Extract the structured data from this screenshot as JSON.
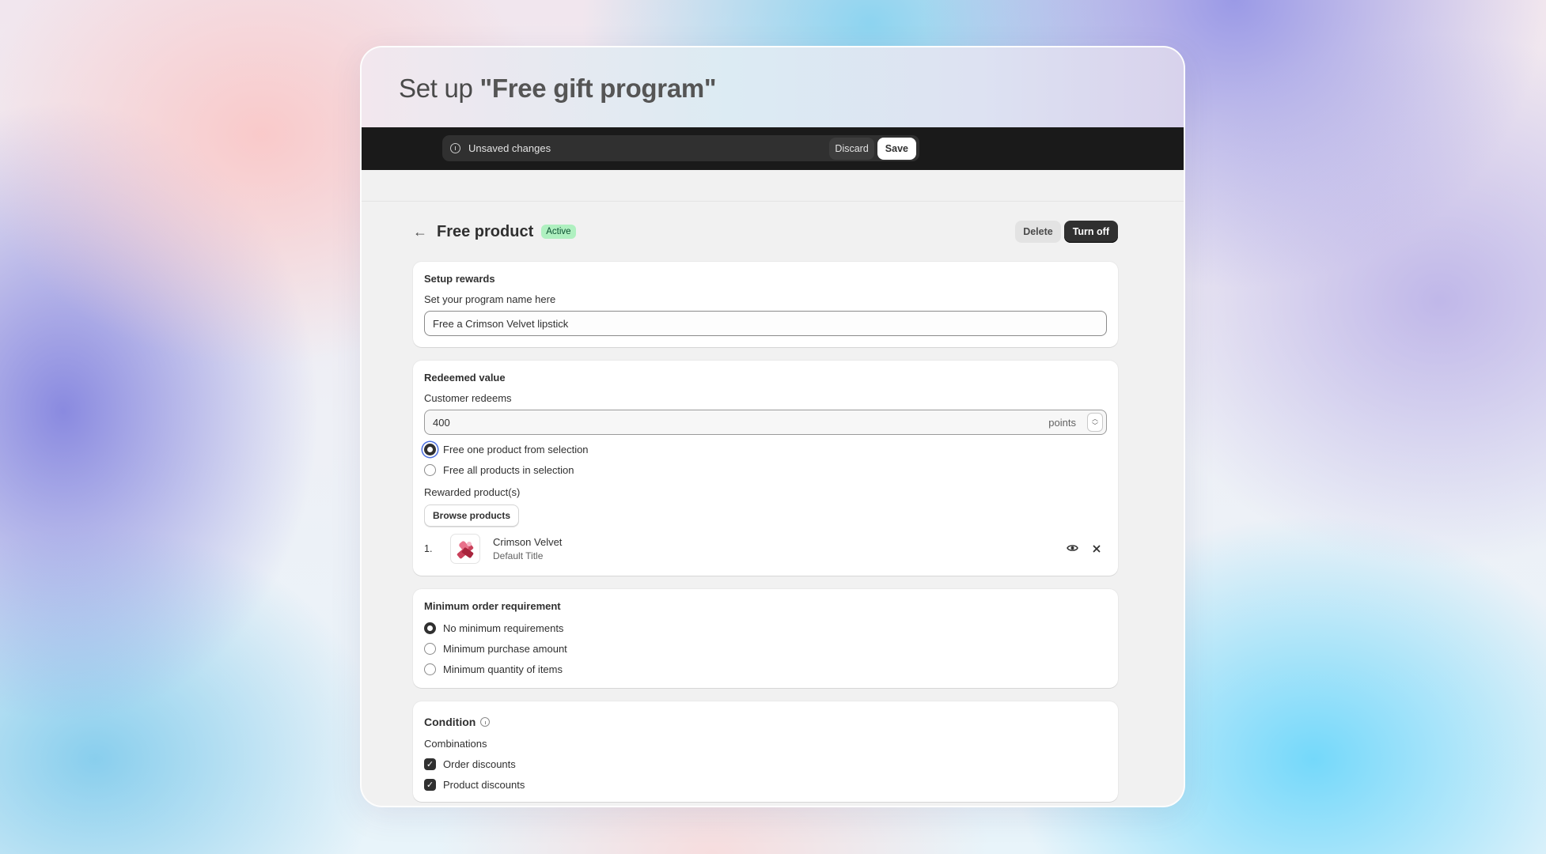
{
  "header": {
    "title_prefix": "Set up ",
    "title_name": "\"Free gift program\""
  },
  "save_bar": {
    "message": "Unsaved changes",
    "discard_label": "Discard",
    "save_label": "Save"
  },
  "page": {
    "title": "Free product",
    "status": "Active",
    "delete_label": "Delete",
    "turn_off_label": "Turn off"
  },
  "setup_rewards": {
    "title": "Setup rewards",
    "name_label": "Set your program name here",
    "name_value": "Free a Crimson Velvet lipstick"
  },
  "redeemed_value": {
    "title": "Redeemed value",
    "redeems_label": "Customer redeems",
    "points_value": "400",
    "points_suffix": "points",
    "options": [
      {
        "label": "Free one product from selection",
        "selected": true
      },
      {
        "label": "Free all products in selection",
        "selected": false
      }
    ],
    "rewarded_label": "Rewarded product(s)",
    "browse_label": "Browse products",
    "products": [
      {
        "index": "1.",
        "name": "Crimson Velvet",
        "variant": "Default Title"
      }
    ]
  },
  "minimum_order": {
    "title": "Minimum order requirement",
    "options": [
      {
        "label": "No minimum requirements",
        "selected": true
      },
      {
        "label": "Minimum purchase amount",
        "selected": false
      },
      {
        "label": "Minimum quantity of items",
        "selected": false
      }
    ]
  },
  "condition": {
    "title": "Condition",
    "combinations_label": "Combinations",
    "checks": [
      {
        "label": "Order discounts",
        "checked": true
      },
      {
        "label": "Product discounts",
        "checked": true
      }
    ]
  },
  "icons": {
    "back": "arrow-left-icon",
    "info": "info-icon",
    "view": "eye-icon",
    "remove": "close-icon",
    "check": "checkmark-icon"
  },
  "colors": {
    "active_badge_bg": "#aff0c0",
    "active_badge_text": "#0c5132",
    "primary_button": "#303030",
    "save_bar": "#1a1a1a"
  }
}
